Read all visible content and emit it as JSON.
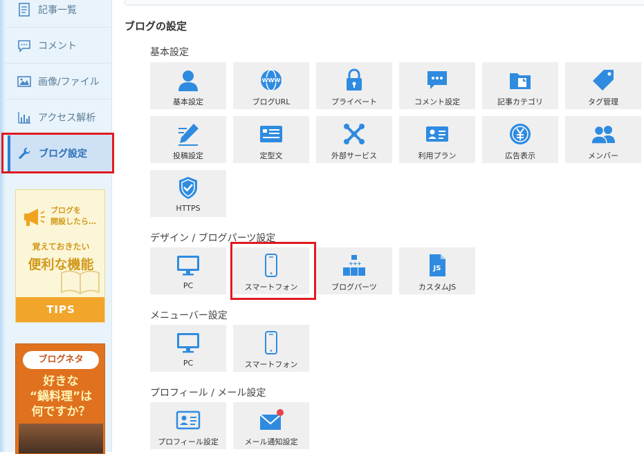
{
  "sidebar": {
    "items": [
      {
        "label": "記事一覧",
        "icon": "document-list-icon"
      },
      {
        "label": "コメント",
        "icon": "comment-icon"
      },
      {
        "label": "画像/ファイル",
        "icon": "image-icon"
      },
      {
        "label": "アクセス解析",
        "icon": "bar-chart-icon"
      },
      {
        "label": "ブログ設定",
        "icon": "wrench-icon",
        "active": true
      }
    ],
    "banner_tips": {
      "line1": "ブログを",
      "line2": "開設したら…",
      "line3": "覚えておきたい",
      "line4": "便利な機能",
      "footer": "TIPS"
    },
    "banner_neta": {
      "pill": "ブログネタ",
      "line1": "好きな",
      "line2": "“鍋料理”は",
      "line3": "何ですか？"
    }
  },
  "main": {
    "title": "ブログの設定",
    "sections": [
      {
        "title": "基本設定",
        "tiles": [
          "基本設定",
          "ブログURL",
          "プライベート",
          "コメント設定",
          "記事カテゴリ",
          "タグ管理",
          "投稿設定",
          "定型文",
          "外部サービス",
          "利用プラン",
          "広告表示",
          "メンバー",
          "HTTPS"
        ]
      },
      {
        "title": "デザイン / ブログパーツ設定",
        "tiles": [
          "PC",
          "スマートフォン",
          "ブログパーツ",
          "カスタムJS"
        ]
      },
      {
        "title": "メニューバー設定",
        "tiles": [
          "PC",
          "スマートフォン"
        ]
      },
      {
        "title": "プロフィール / メール設定",
        "tiles": [
          "プロフィール設定",
          "メール通知設定"
        ]
      }
    ]
  },
  "colors": {
    "accent": "#2d7fd3",
    "icon_blue": "#2f8be0",
    "highlight": "#e0191f",
    "tile_bg": "#efefef"
  }
}
